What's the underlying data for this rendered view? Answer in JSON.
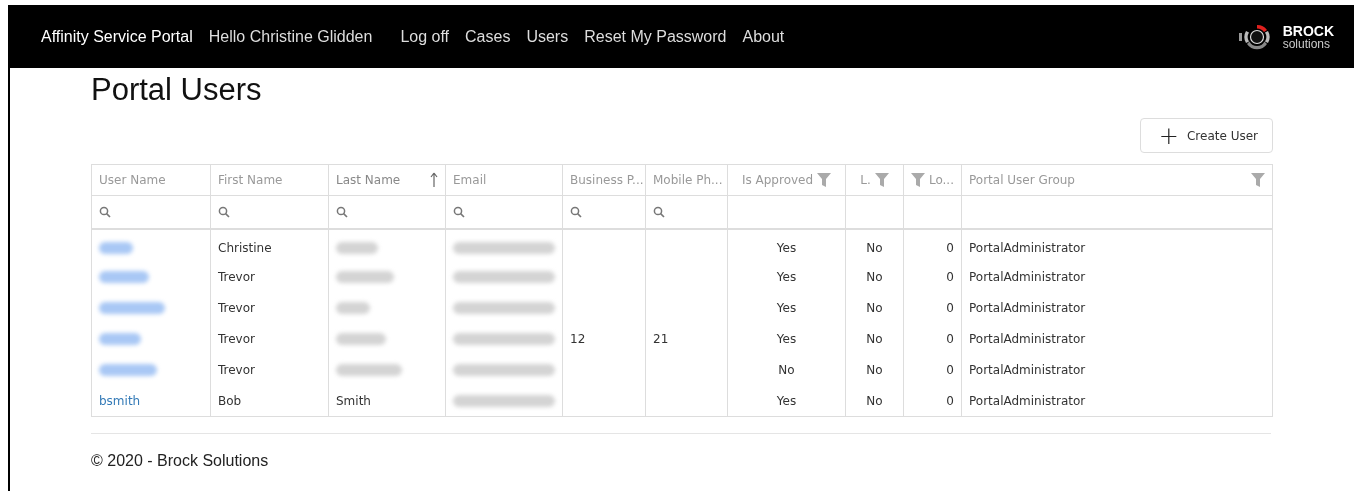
{
  "navbar": {
    "brand": "Affinity Service Portal",
    "greeting": "Hello Christine Glidden",
    "links": [
      "Log off",
      "Cases",
      "Users",
      "Reset My Password",
      "About"
    ],
    "logo": {
      "name": "BROCK",
      "sub": "solutions"
    }
  },
  "page_title": "Portal Users",
  "create_button": {
    "icon": "+",
    "label": "Create User"
  },
  "table": {
    "columns": [
      {
        "label": "User Name",
        "kind": "search",
        "sorted": false
      },
      {
        "label": "First Name",
        "kind": "search",
        "sorted": false
      },
      {
        "label": "Last Name",
        "kind": "search",
        "sorted": true
      },
      {
        "label": "Email",
        "kind": "search",
        "sorted": false
      },
      {
        "label": "Business P...",
        "kind": "search",
        "sorted": false
      },
      {
        "label": "Mobile Ph...",
        "kind": "search",
        "sorted": false
      },
      {
        "label": "Is Approved",
        "kind": "filter-after",
        "sorted": false
      },
      {
        "label": "L.",
        "kind": "filter-after",
        "sorted": false
      },
      {
        "label": "Lo...",
        "kind": "filter-before",
        "sorted": false
      },
      {
        "label": "Portal User Group",
        "kind": "filter-end",
        "sorted": false
      }
    ],
    "rows": [
      {
        "cells": [
          {
            "kind": "redacted-link"
          },
          {
            "kind": "text",
            "text": "Christine"
          },
          {
            "kind": "redacted"
          },
          {
            "kind": "redacted"
          },
          {
            "kind": "empty"
          },
          {
            "kind": "empty"
          },
          {
            "kind": "text",
            "text": "Yes"
          },
          {
            "kind": "text",
            "text": "No"
          },
          {
            "kind": "text",
            "text": "0"
          },
          {
            "kind": "text",
            "text": "PortalAdministrator"
          }
        ]
      },
      {
        "cells": [
          {
            "kind": "redacted-link"
          },
          {
            "kind": "text",
            "text": "Trevor"
          },
          {
            "kind": "redacted"
          },
          {
            "kind": "redacted"
          },
          {
            "kind": "empty"
          },
          {
            "kind": "empty"
          },
          {
            "kind": "text",
            "text": "Yes"
          },
          {
            "kind": "text",
            "text": "No"
          },
          {
            "kind": "text",
            "text": "0"
          },
          {
            "kind": "text",
            "text": "PortalAdministrator"
          }
        ]
      },
      {
        "cells": [
          {
            "kind": "redacted-link"
          },
          {
            "kind": "text",
            "text": "Trevor"
          },
          {
            "kind": "redacted"
          },
          {
            "kind": "redacted"
          },
          {
            "kind": "empty"
          },
          {
            "kind": "empty"
          },
          {
            "kind": "text",
            "text": "Yes"
          },
          {
            "kind": "text",
            "text": "No"
          },
          {
            "kind": "text",
            "text": "0"
          },
          {
            "kind": "text",
            "text": "PortalAdministrator"
          }
        ]
      },
      {
        "cells": [
          {
            "kind": "redacted-link"
          },
          {
            "kind": "text",
            "text": "Trevor"
          },
          {
            "kind": "redacted"
          },
          {
            "kind": "redacted"
          },
          {
            "kind": "text",
            "text": "12"
          },
          {
            "kind": "text",
            "text": "21"
          },
          {
            "kind": "text",
            "text": "Yes"
          },
          {
            "kind": "text",
            "text": "No"
          },
          {
            "kind": "text",
            "text": "0"
          },
          {
            "kind": "text",
            "text": "PortalAdministrator"
          }
        ]
      },
      {
        "cells": [
          {
            "kind": "redacted-link"
          },
          {
            "kind": "text",
            "text": "Trevor"
          },
          {
            "kind": "redacted"
          },
          {
            "kind": "redacted"
          },
          {
            "kind": "empty"
          },
          {
            "kind": "empty"
          },
          {
            "kind": "text",
            "text": "No"
          },
          {
            "kind": "text",
            "text": "No"
          },
          {
            "kind": "text",
            "text": "0"
          },
          {
            "kind": "text",
            "text": "PortalAdministrator"
          }
        ]
      },
      {
        "cells": [
          {
            "kind": "link",
            "text": "bsmith"
          },
          {
            "kind": "text",
            "text": "Bob"
          },
          {
            "kind": "text",
            "text": "Smith"
          },
          {
            "kind": "redacted"
          },
          {
            "kind": "empty"
          },
          {
            "kind": "empty"
          },
          {
            "kind": "text",
            "text": "Yes"
          },
          {
            "kind": "text",
            "text": "No"
          },
          {
            "kind": "text",
            "text": "0"
          },
          {
            "kind": "text",
            "text": "PortalAdministrator"
          }
        ]
      }
    ]
  },
  "footer": "© 2020 - Brock Solutions"
}
